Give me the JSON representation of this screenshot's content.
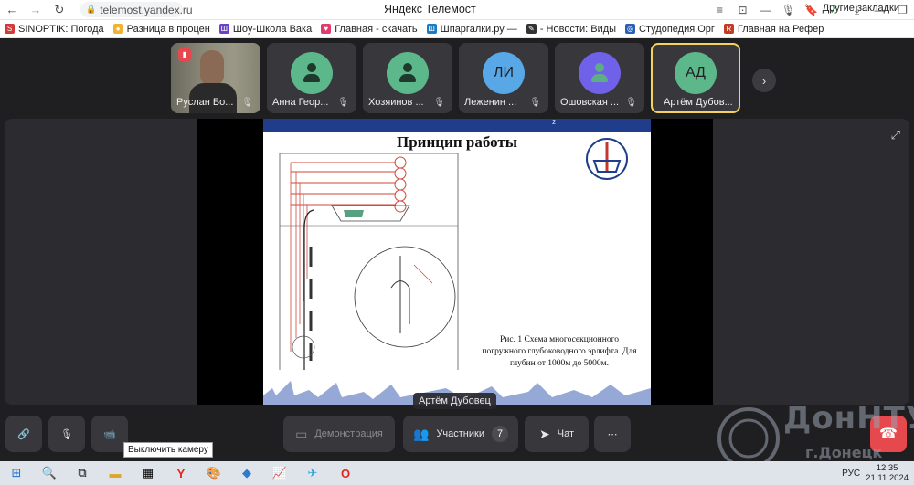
{
  "browser": {
    "url": "telemost.yandex.ru",
    "title": "Яндекс Телемост",
    "bookmarks": [
      {
        "label": "SINOPTIK: Погода",
        "color": "#d23a3a",
        "glyph": "S"
      },
      {
        "label": "Разница в процен",
        "color": "#f2b233",
        "glyph": "●"
      },
      {
        "label": "Шоу-Школа Вака",
        "color": "#6b42c7",
        "glyph": "Ш"
      },
      {
        "label": "Главная - скачать",
        "color": "#e23a6a",
        "glyph": "♥"
      },
      {
        "label": "Шпаргалки.ру —",
        "color": "#1b7cc4",
        "glyph": "Ш"
      },
      {
        "label": "- Новости: Виды",
        "color": "#333333",
        "glyph": "✎"
      },
      {
        "label": "Студопедия.Орг",
        "color": "#2a5fb5",
        "glyph": "◎"
      },
      {
        "label": "Главная на Рефер",
        "color": "#c23b22",
        "glyph": "R"
      }
    ],
    "other_bookmarks": "Другие закладки"
  },
  "participants": [
    {
      "name": "Руслан Бо...",
      "type": "video"
    },
    {
      "name": "Анна Геор...",
      "type": "icon",
      "color": "#5cb88a"
    },
    {
      "name": "Хозяинов ...",
      "type": "icon",
      "color": "#5cb88a"
    },
    {
      "name": "Леженин ...",
      "type": "initials",
      "initials": "ЛИ",
      "color": "#58a8e8"
    },
    {
      "name": "Ошовская ...",
      "type": "icon",
      "color": "#6f62e8"
    },
    {
      "name": "Артём Дубов...",
      "type": "initials",
      "initials": "АД",
      "color": "#5cb88a",
      "active": true
    }
  ],
  "slide": {
    "number": "2",
    "title": "Принцип работы",
    "caption": "Рис. 1 Схема многосекционного погружного глубоководного эрлифта. Для глубин от 1000м до 5000м."
  },
  "presenter": "Артём Дубовец",
  "toolbar": {
    "demo_label": "Демонстрация",
    "participants_label": "Участники",
    "participants_count": "7",
    "chat_label": "Чат",
    "camera_tooltip": "Выключить камеру"
  },
  "watermark": {
    "title": "ДонНТУ",
    "subtitle": "г.Донецк"
  },
  "taskbar": {
    "language": "РУС",
    "time": "12:35",
    "date": "21.11.2024"
  }
}
